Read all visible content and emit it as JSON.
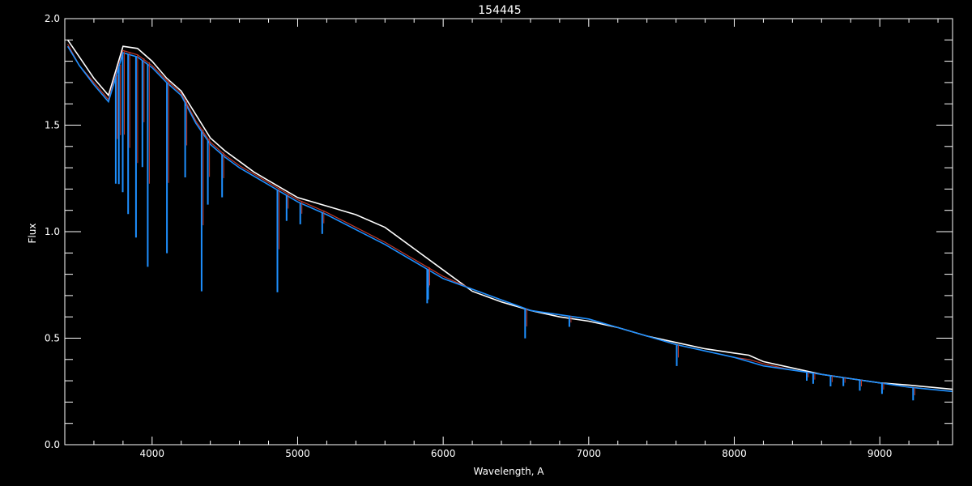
{
  "chart_data": {
    "type": "line",
    "title": "154445",
    "xlabel": "Wavelength, A",
    "ylabel": "Flux",
    "xlim": [
      3400,
      9500
    ],
    "ylim": [
      0.0,
      2.0
    ],
    "xticks": [
      4000,
      5000,
      6000,
      7000,
      8000,
      9000
    ],
    "xtick_labels": [
      "4000",
      "5000",
      "6000",
      "7000",
      "8000",
      "9000"
    ],
    "yticks": [
      0.0,
      0.5,
      1.0,
      1.5,
      2.0
    ],
    "ytick_labels": [
      "0.0",
      "0.5",
      "1.0",
      "1.5",
      "2.0"
    ],
    "grid": false,
    "background": "#000000",
    "axis_color": "#ffffff",
    "series": [
      {
        "color": "#ffffff",
        "x": [
          3420,
          3500,
          3600,
          3700,
          3800,
          3900,
          4000,
          4100,
          4200,
          4300,
          4400,
          4500,
          4600,
          4700,
          4800,
          4900,
          5000,
          5200,
          5400,
          5600,
          5800,
          6000,
          6200,
          6400,
          6600,
          6800,
          7000,
          7200,
          7400,
          7600,
          7800,
          8000,
          8100,
          8200,
          8400,
          8600,
          8800,
          9000,
          9200,
          9500
        ],
        "y": [
          1.9,
          1.82,
          1.72,
          1.64,
          1.87,
          1.86,
          1.8,
          1.72,
          1.66,
          1.55,
          1.44,
          1.38,
          1.33,
          1.28,
          1.24,
          1.2,
          1.16,
          1.12,
          1.08,
          1.02,
          0.92,
          0.82,
          0.72,
          0.67,
          0.63,
          0.6,
          0.58,
          0.55,
          0.51,
          0.48,
          0.45,
          0.43,
          0.42,
          0.39,
          0.36,
          0.33,
          0.31,
          0.29,
          0.28,
          0.26
        ]
      },
      {
        "color": "#c0392b",
        "x": [
          3420,
          3500,
          3600,
          3700,
          3800,
          3900,
          4000,
          4100,
          4200,
          4300,
          4400,
          4500,
          4600,
          4700,
          4800,
          4900,
          5000,
          5200,
          5400,
          5600,
          5800,
          6000,
          6200,
          6400,
          6600,
          6800,
          7000,
          7200,
          7400,
          7600,
          7800,
          8000,
          8100,
          8200,
          8400,
          8600,
          8800,
          9000,
          9200,
          9500
        ],
        "y": [
          1.88,
          1.78,
          1.7,
          1.62,
          1.85,
          1.83,
          1.78,
          1.71,
          1.65,
          1.52,
          1.42,
          1.36,
          1.31,
          1.27,
          1.23,
          1.19,
          1.15,
          1.09,
          1.02,
          0.95,
          0.87,
          0.79,
          0.73,
          0.68,
          0.63,
          0.61,
          0.59,
          0.55,
          0.51,
          0.47,
          0.44,
          0.41,
          0.4,
          0.38,
          0.35,
          0.33,
          0.31,
          0.29,
          0.27,
          0.25
        ]
      },
      {
        "color": "#1e90ff",
        "x": [
          3420,
          3500,
          3600,
          3700,
          3800,
          3900,
          4000,
          4100,
          4200,
          4300,
          4400,
          4500,
          4600,
          4700,
          4800,
          4900,
          5000,
          5200,
          5400,
          5600,
          5800,
          6000,
          6200,
          6400,
          6600,
          6800,
          7000,
          7200,
          7400,
          7600,
          7800,
          8000,
          8100,
          8200,
          8400,
          8600,
          8800,
          9000,
          9200,
          9500
        ],
        "y": [
          1.87,
          1.78,
          1.69,
          1.61,
          1.84,
          1.82,
          1.77,
          1.7,
          1.64,
          1.51,
          1.41,
          1.35,
          1.3,
          1.26,
          1.22,
          1.18,
          1.14,
          1.08,
          1.01,
          0.94,
          0.86,
          0.78,
          0.73,
          0.68,
          0.63,
          0.61,
          0.59,
          0.55,
          0.51,
          0.47,
          0.44,
          0.41,
          0.39,
          0.37,
          0.35,
          0.33,
          0.31,
          0.29,
          0.27,
          0.25
        ]
      }
    ],
    "absorption_lines": [
      {
        "x": 3750,
        "depth": 0.5
      },
      {
        "x": 3771,
        "depth": 0.55
      },
      {
        "x": 3798,
        "depth": 0.65
      },
      {
        "x": 3835,
        "depth": 0.75
      },
      {
        "x": 3889,
        "depth": 0.85
      },
      {
        "x": 3933,
        "depth": 0.5
      },
      {
        "x": 3970,
        "depth": 0.95
      },
      {
        "x": 4102,
        "depth": 0.8
      },
      {
        "x": 4227,
        "depth": 0.35
      },
      {
        "x": 4340,
        "depth": 0.75
      },
      {
        "x": 4383,
        "depth": 0.3
      },
      {
        "x": 4481,
        "depth": 0.2
      },
      {
        "x": 4861,
        "depth": 0.48
      },
      {
        "x": 4924,
        "depth": 0.12
      },
      {
        "x": 5018,
        "depth": 0.1
      },
      {
        "x": 5169,
        "depth": 0.1
      },
      {
        "x": 5890,
        "depth": 0.16
      },
      {
        "x": 5896,
        "depth": 0.14
      },
      {
        "x": 6563,
        "depth": 0.14
      },
      {
        "x": 6867,
        "depth": 0.05
      },
      {
        "x": 7605,
        "depth": 0.1
      },
      {
        "x": 8498,
        "depth": 0.04
      },
      {
        "x": 8542,
        "depth": 0.05
      },
      {
        "x": 8662,
        "depth": 0.05
      },
      {
        "x": 8750,
        "depth": 0.04
      },
      {
        "x": 8863,
        "depth": 0.05
      },
      {
        "x": 9015,
        "depth": 0.05
      },
      {
        "x": 9229,
        "depth": 0.06
      }
    ]
  }
}
